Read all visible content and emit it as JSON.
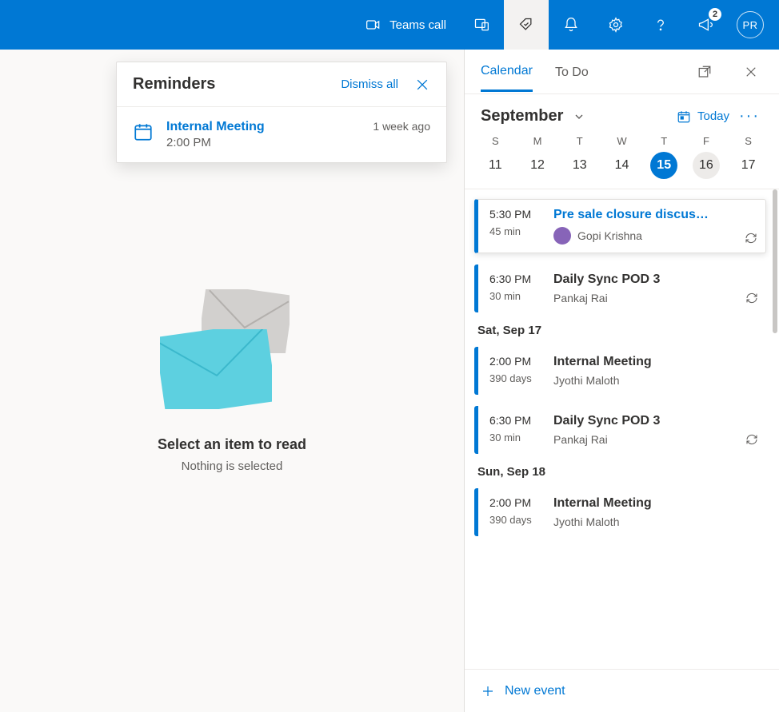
{
  "header": {
    "teams_call": "Teams call",
    "notification_count": "2",
    "avatar_initials": "PR"
  },
  "reminders": {
    "title": "Reminders",
    "dismiss_all": "Dismiss all",
    "item": {
      "title": "Internal Meeting",
      "time": "2:00 PM",
      "ago": "1 week ago"
    }
  },
  "main": {
    "select_title": "Select an item to read",
    "select_sub": "Nothing is selected"
  },
  "side": {
    "tabs": {
      "calendar": "Calendar",
      "todo": "To Do"
    },
    "month": "September",
    "today_label": "Today",
    "days_of_week": [
      "S",
      "M",
      "T",
      "W",
      "T",
      "F",
      "S"
    ],
    "day_numbers": [
      "11",
      "12",
      "13",
      "14",
      "15",
      "16",
      "17"
    ],
    "selected_index": 4,
    "today_index": 5,
    "events": [
      {
        "time": "5:30 PM",
        "dur": "45 min",
        "title": "Pre sale closure discus…",
        "organizer": "Gopi Krishna",
        "highlight": true,
        "recurring": true,
        "avatar": true,
        "link": true
      },
      {
        "time": "6:30 PM",
        "dur": "30 min",
        "title": "Daily Sync POD 3",
        "organizer": "Pankaj Rai",
        "recurring": true
      },
      {
        "header": "Sat, Sep 17"
      },
      {
        "time": "2:00 PM",
        "dur": "390 days",
        "title": "Internal Meeting",
        "organizer": "Jyothi Maloth"
      },
      {
        "time": "6:30 PM",
        "dur": "30 min",
        "title": "Daily Sync POD 3",
        "organizer": "Pankaj Rai",
        "recurring": true
      },
      {
        "header": "Sun, Sep 18"
      },
      {
        "time": "2:00 PM",
        "dur": "390 days",
        "title": "Internal Meeting",
        "organizer": "Jyothi Maloth"
      }
    ],
    "new_event": "New event"
  }
}
